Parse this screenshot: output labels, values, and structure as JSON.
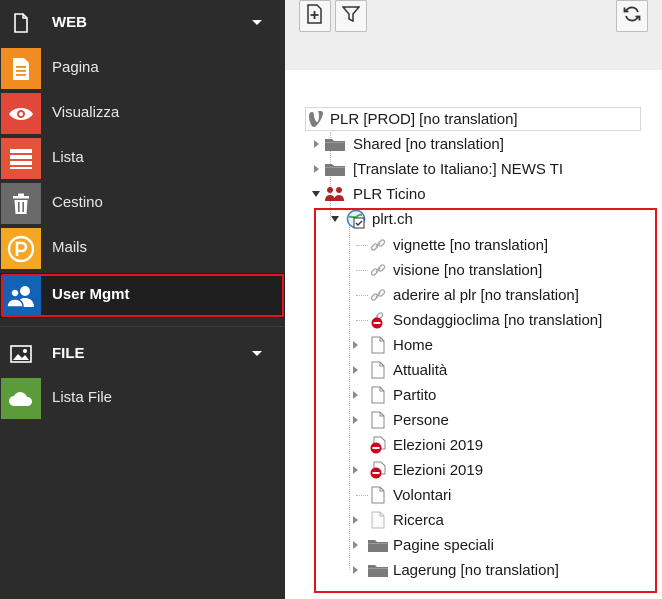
{
  "module_menu": {
    "groups": [
      {
        "label": "WEB",
        "icon": "document-icon"
      },
      {
        "label": "FILE",
        "icon": "image-icon"
      }
    ],
    "web_modules": [
      {
        "label": "Pagina",
        "icon": "page-icon",
        "color": "#f08c20"
      },
      {
        "label": "Visualizza",
        "icon": "eye-icon",
        "color": "#e2483a"
      },
      {
        "label": "Lista",
        "icon": "list-icon",
        "color": "#e2533a"
      },
      {
        "label": "Cestino",
        "icon": "trash-icon",
        "color": "#6a6a6a"
      },
      {
        "label": "Mails",
        "icon": "mail-icon",
        "color": "#f5a623"
      },
      {
        "label": "User Mgmt",
        "icon": "users-icon",
        "color": "#1462b5"
      }
    ],
    "file_modules": [
      {
        "label": "Lista File",
        "icon": "cloud-icon",
        "color": "#5b9b3a"
      }
    ],
    "active_module": "User Mgmt"
  },
  "tree_toolbar": {
    "buttons": [
      {
        "name": "new-page-icon"
      },
      {
        "name": "filter-icon"
      },
      {
        "name": "refresh-icon"
      }
    ]
  },
  "page_tree": {
    "root": {
      "label": "PLR [PROD] [no translation]",
      "icon": "typo3-logo-icon"
    },
    "nodes": [
      {
        "label": "Shared [no translation]",
        "icon": "folder-icon"
      },
      {
        "label": "[Translate to Italiano:] NEWS TI",
        "icon": "folder-icon"
      },
      {
        "label": "PLR Ticino",
        "icon": "user-group-icon"
      },
      {
        "label": "plrt.ch",
        "icon": "site-root-icon"
      },
      {
        "label": "vignette [no translation]",
        "icon": "link-icon"
      },
      {
        "label": "visione [no translation]",
        "icon": "link-icon"
      },
      {
        "label": "aderire al plr [no translation]",
        "icon": "link-icon"
      },
      {
        "label": "Sondaggioclima [no translation]",
        "icon": "link-restricted-icon"
      },
      {
        "label": "Home",
        "icon": "page-icon"
      },
      {
        "label": "Attualità",
        "icon": "page-icon"
      },
      {
        "label": "Partito",
        "icon": "page-icon"
      },
      {
        "label": "Persone",
        "icon": "page-icon"
      },
      {
        "label": "Elezioni 2019",
        "icon": "page-restricted-icon"
      },
      {
        "label": "Elezioni 2019",
        "icon": "page-restricted-icon"
      },
      {
        "label": "Volontari",
        "icon": "page-icon"
      },
      {
        "label": "Ricerca",
        "icon": "page-icon"
      },
      {
        "label": "Pagine speciali",
        "icon": "folder-icon"
      },
      {
        "label": "Lagerung [no translation]",
        "icon": "folder-icon"
      }
    ]
  },
  "colors": {
    "sidebar_bg": "#2c2c2c",
    "highlight": "#e2141c"
  }
}
